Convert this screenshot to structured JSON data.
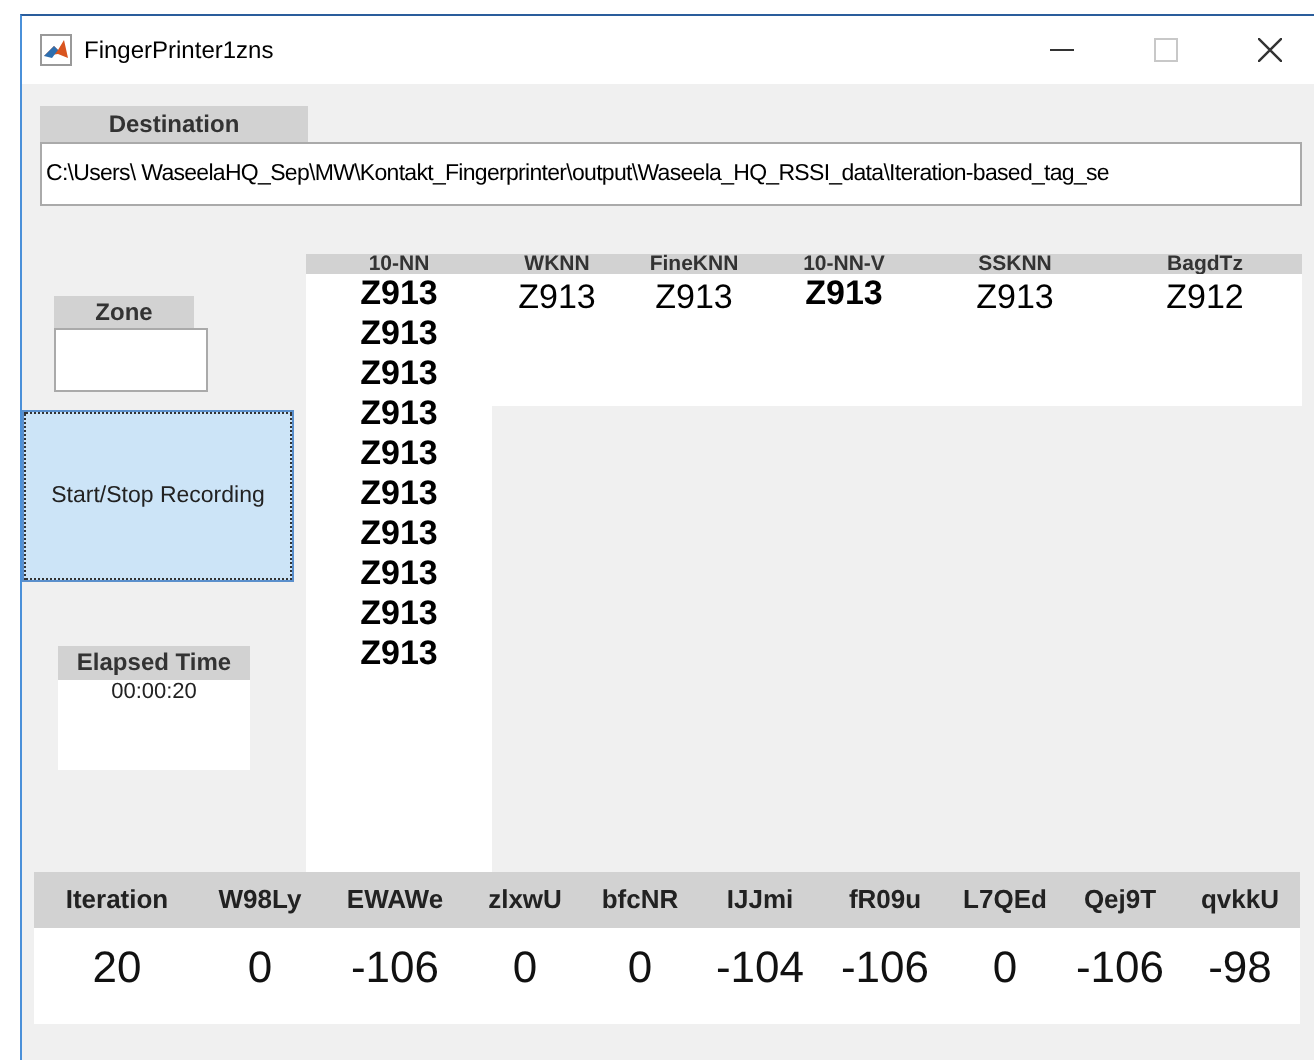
{
  "window": {
    "title": "FingerPrinter1zns",
    "maximize_disabled": true
  },
  "destination": {
    "label": "Destination",
    "value": "C:\\Users\\ WaseelaHQ_Sep\\MW\\Kontakt_Fingerprinter\\output\\Waseela_HQ_RSSI_data\\Iteration-based_tag_se"
  },
  "zone": {
    "label": "Zone"
  },
  "record_button": {
    "label": "Start/Stop Recording"
  },
  "elapsed": {
    "label": "Elapsed Time",
    "value": "00:00:20"
  },
  "results": {
    "columns": [
      {
        "header": "10-NN",
        "bold": true,
        "values": [
          "Z913",
          "Z913",
          "Z913",
          "Z913",
          "Z913",
          "Z913",
          "Z913",
          "Z913",
          "Z913",
          "Z913"
        ]
      },
      {
        "header": "WKNN",
        "bold": false,
        "values": [
          "Z913"
        ]
      },
      {
        "header": "FineKNN",
        "bold": false,
        "values": [
          "Z913"
        ]
      },
      {
        "header": "10-NN-V",
        "bold": true,
        "values": [
          "Z913"
        ]
      },
      {
        "header": "SSKNN",
        "bold": false,
        "values": [
          "Z913"
        ]
      },
      {
        "header": "BagdTz",
        "bold": false,
        "values": [
          "Z912"
        ]
      }
    ]
  },
  "readings": {
    "columns": [
      {
        "header": "Iteration",
        "value": "20"
      },
      {
        "header": "W98Ly",
        "value": "0"
      },
      {
        "header": "EWAWe",
        "value": "-106"
      },
      {
        "header": "zlxwU",
        "value": "0"
      },
      {
        "header": "bfcNR",
        "value": "0"
      },
      {
        "header": "IJJmi",
        "value": "-104"
      },
      {
        "header": "fR09u",
        "value": "-106"
      },
      {
        "header": "L7QEd",
        "value": "0"
      },
      {
        "header": "Qej9T",
        "value": "-106"
      },
      {
        "header": "qvkkU",
        "value": "-98"
      }
    ]
  }
}
